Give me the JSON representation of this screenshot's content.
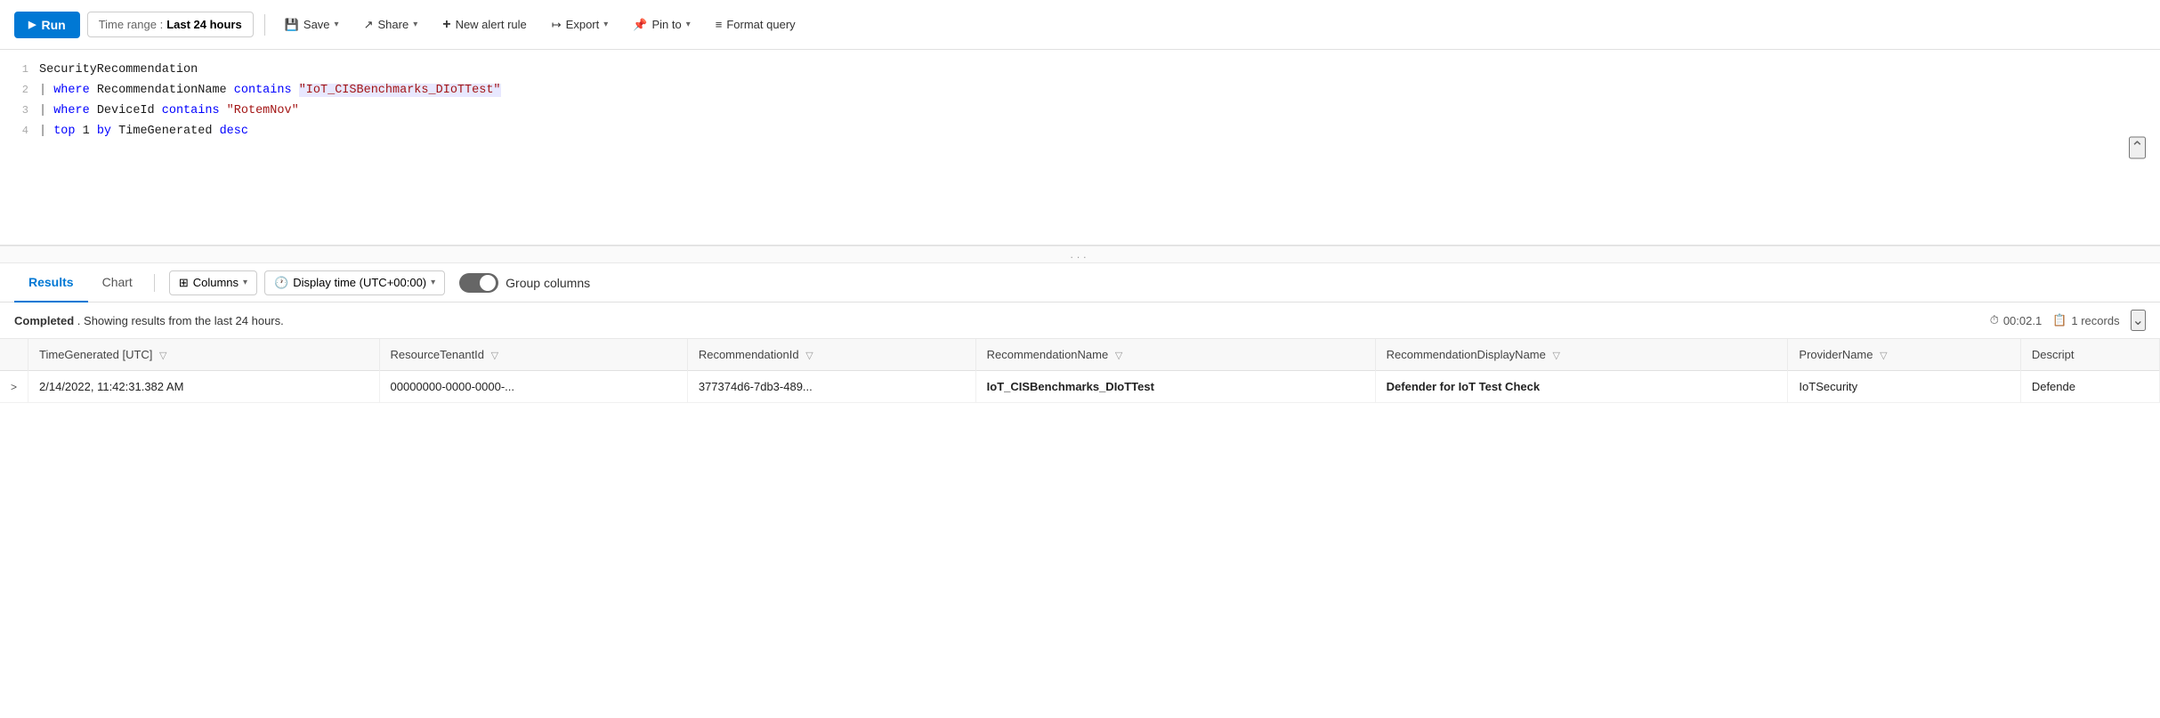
{
  "toolbar": {
    "run_label": "Run",
    "time_range_prefix": "Time range : ",
    "time_range_value": "Last 24 hours",
    "save_label": "Save",
    "share_label": "Share",
    "new_alert_label": "New alert rule",
    "export_label": "Export",
    "pin_to_label": "Pin to",
    "format_query_label": "Format query"
  },
  "editor": {
    "lines": [
      {
        "num": "1",
        "content_raw": "SecurityRecommendation"
      },
      {
        "num": "2",
        "content_raw": "| where RecommendationName contains \"IoT_CISBenchmarks_DIoTTest\""
      },
      {
        "num": "3",
        "content_raw": "| where DeviceId contains \"RotemNov\""
      },
      {
        "num": "4",
        "content_raw": "| top 1 by TimeGenerated desc"
      }
    ]
  },
  "drag_handle_dots": "...",
  "results": {
    "tab_results": "Results",
    "tab_chart": "Chart",
    "columns_label": "Columns",
    "display_time_label": "Display time (UTC+00:00)",
    "group_columns_label": "Group columns",
    "status_complete": "Completed",
    "status_text": ". Showing results from the last 24 hours.",
    "timer": "00:02.1",
    "records_count": "1 records",
    "expand_icon": "⌄",
    "table": {
      "headers": [
        "TimeGenerated [UTC]",
        "ResourceTenantId",
        "RecommendationId",
        "RecommendationName",
        "RecommendationDisplayName",
        "ProviderName",
        "Descript"
      ],
      "rows": [
        {
          "expand": ">",
          "time_generated": "2/14/2022, 11:42:31.382 AM",
          "resource_tenant": "00000000-0000-0000-...",
          "recommendation_id": "377374d6-7db3-489...",
          "recommendation_name": "IoT_CISBenchmarks_DIoTTest",
          "recommendation_display": "Defender for IoT Test Check",
          "provider_name": "IoTSecurity",
          "description": "Defende"
        }
      ]
    }
  }
}
